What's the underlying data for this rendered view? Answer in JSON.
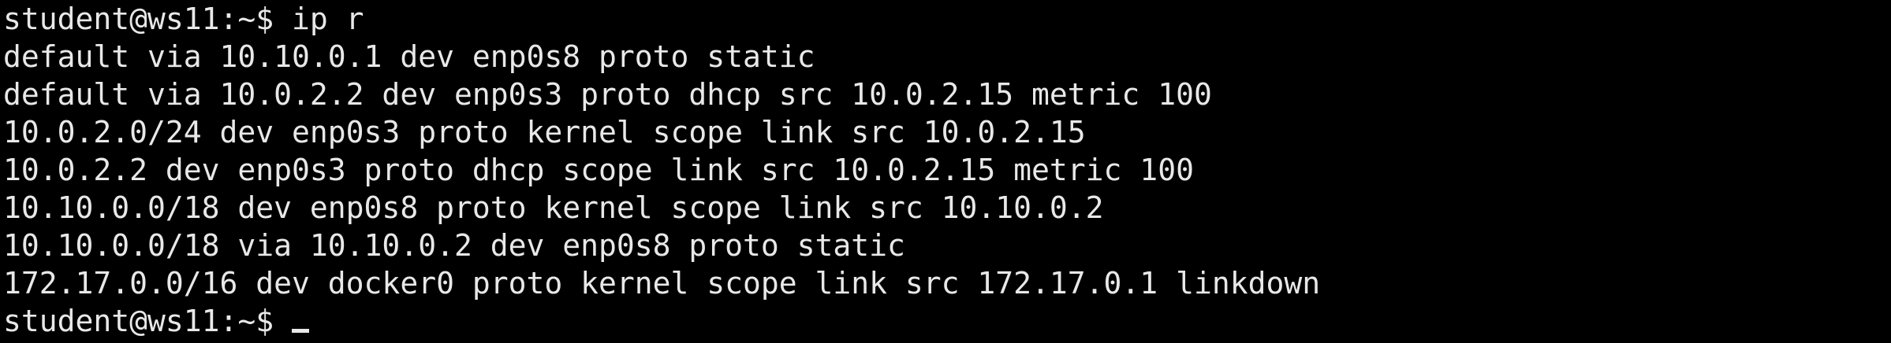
{
  "terminal": {
    "prompt": "student@ws11:~$ ",
    "command": "ip r",
    "output": [
      "default via 10.10.0.1 dev enp0s8 proto static",
      "default via 10.0.2.2 dev enp0s3 proto dhcp src 10.0.2.15 metric 100",
      "10.0.2.0/24 dev enp0s3 proto kernel scope link src 10.0.2.15",
      "10.0.2.2 dev enp0s3 proto dhcp scope link src 10.0.2.15 metric 100",
      "10.10.0.0/18 dev enp0s8 proto kernel scope link src 10.10.0.2",
      "10.10.0.0/18 via 10.10.0.2 dev enp0s8 proto static",
      "172.17.0.0/16 dev docker0 proto kernel scope link src 172.17.0.1 linkdown"
    ],
    "final_prompt": "student@ws11:~$ "
  },
  "colors": {
    "background": "#000000",
    "foreground": "#e8e8e8"
  }
}
